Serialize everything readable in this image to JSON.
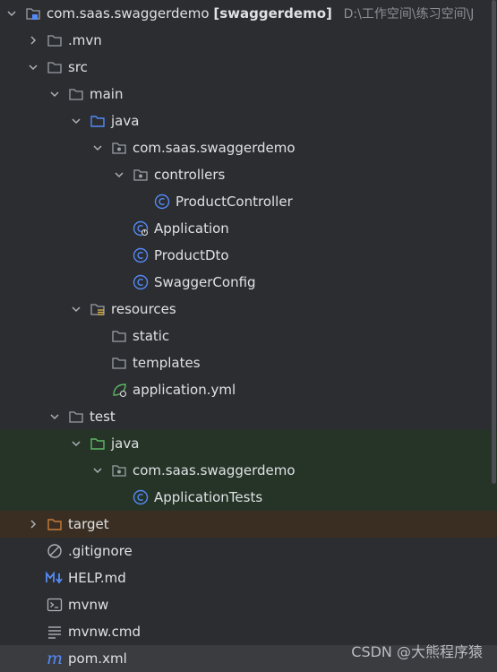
{
  "tree": {
    "root": {
      "name": "com.saas.swaggerdemo",
      "module": "[swaggerdemo]",
      "path": "D:\\工作空间\\练习空间\\J"
    },
    "items": [
      {
        "label": ".mvn"
      },
      {
        "label": "src"
      },
      {
        "label": "main"
      },
      {
        "label": "java"
      },
      {
        "label": "com.saas.swaggerdemo"
      },
      {
        "label": "controllers"
      },
      {
        "label": "ProductController"
      },
      {
        "label": "Application"
      },
      {
        "label": "ProductDto"
      },
      {
        "label": "SwaggerConfig"
      },
      {
        "label": "resources"
      },
      {
        "label": "static"
      },
      {
        "label": "templates"
      },
      {
        "label": "application.yml"
      },
      {
        "label": "test"
      },
      {
        "label": "java"
      },
      {
        "label": "com.saas.swaggerdemo"
      },
      {
        "label": "ApplicationTests"
      },
      {
        "label": "target"
      },
      {
        "label": ".gitignore"
      },
      {
        "label": "HELP.md"
      },
      {
        "label": "mvnw"
      },
      {
        "label": "mvnw.cmd"
      },
      {
        "label": "pom.xml"
      }
    ]
  },
  "watermark": "CSDN @大熊程序猿",
  "colors": {
    "background": "#2b2d30",
    "text": "#dfe1e5",
    "folder_icon": "#9aa0a6",
    "source_folder_icon": "#548af7",
    "test_folder_icon": "#5fb865",
    "excluded_folder_icon": "#c77d3a",
    "class_icon": "#548af7",
    "test_highlight": "#253427",
    "excluded_highlight": "#3a2e22"
  }
}
